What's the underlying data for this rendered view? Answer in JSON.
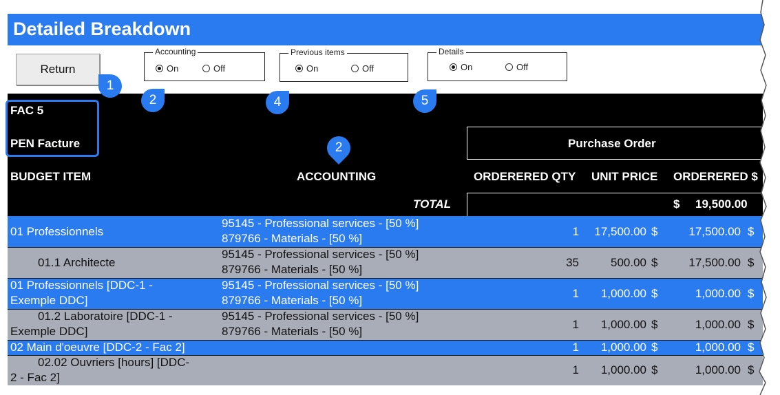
{
  "title": "Detailed Breakdown",
  "return_label": "Return",
  "groups": {
    "accounting": {
      "legend": "Accounting",
      "on": "On",
      "off": "Off",
      "selected": "On"
    },
    "previous": {
      "legend": "Previous items",
      "on": "On",
      "off": "Off",
      "selected": "On"
    },
    "details": {
      "legend": "Details",
      "on": "On",
      "off": "Off",
      "selected": "On"
    }
  },
  "callouts": [
    "1",
    "2",
    "4",
    "5",
    "2"
  ],
  "header": {
    "fac": "FAC 5",
    "pen": "PEN Facture",
    "purchase_order": "Purchase Order",
    "budget_item": "BUDGET ITEM",
    "accounting": "ACCOUNTING",
    "ordered_qty": "ORDERERED QTY",
    "unit_price": "UNIT PRICE",
    "ordered_amt": "ORDERERED $",
    "total_label": "TOTAL",
    "total_currency": "$",
    "total_value": "19,500.00"
  },
  "rows": [
    {
      "style": "blue",
      "item_1": "01 Professionnels",
      "item_2": "",
      "acct_1": "95145 - Professional services - [50 %]",
      "acct_2": "879766 - Materials - [50 %]",
      "qty": "1",
      "unit_price": "17,500.00",
      "cur1": "$",
      "ordered": "17,500.00",
      "cur2": "$"
    },
    {
      "style": "gray",
      "item_1": "01.1 Architecte",
      "item_2": "",
      "acct_1": "95145 - Professional services - [50 %]",
      "acct_2": "879766 - Materials - [50 %]",
      "qty": "35",
      "unit_price": "500.00",
      "cur1": "$",
      "ordered": "17,500.00",
      "cur2": "$"
    },
    {
      "style": "blue",
      "item_1": "01 Professionnels [DDC-1 -",
      "item_2": "Exemple DDC]",
      "acct_1": "95145 - Professional services - [50 %]",
      "acct_2": "879766 - Materials - [50 %]",
      "qty": "1",
      "unit_price": "1,000.00",
      "cur1": "$",
      "ordered": "1,000.00",
      "cur2": "$"
    },
    {
      "style": "gray",
      "item_1": "01.2 Laboratoire [DDC-1 -",
      "item_2": "Exemple DDC]",
      "acct_1": "95145 - Professional services - [50 %]",
      "acct_2": "879766 - Materials - [50 %]",
      "qty": "1",
      "unit_price": "1,000.00",
      "cur1": "$",
      "ordered": "1,000.00",
      "cur2": "$"
    },
    {
      "style": "blue",
      "item_1": "02 Main d'oeuvre [DDC-2 - Fac 2]",
      "item_2": "",
      "acct_1": "",
      "acct_2": "",
      "qty": "1",
      "unit_price": "1,000.00",
      "cur1": "$",
      "ordered": "1,000.00",
      "cur2": "$"
    },
    {
      "style": "gray",
      "item_1": "02.02 Ouvriers [hours] [DDC-",
      "item_2": "2 - Fac 2]",
      "acct_1": "",
      "acct_2": "",
      "qty": "1",
      "unit_price": "1,000.00",
      "cur1": "$",
      "ordered": "1,000.00",
      "cur2": "$"
    }
  ]
}
